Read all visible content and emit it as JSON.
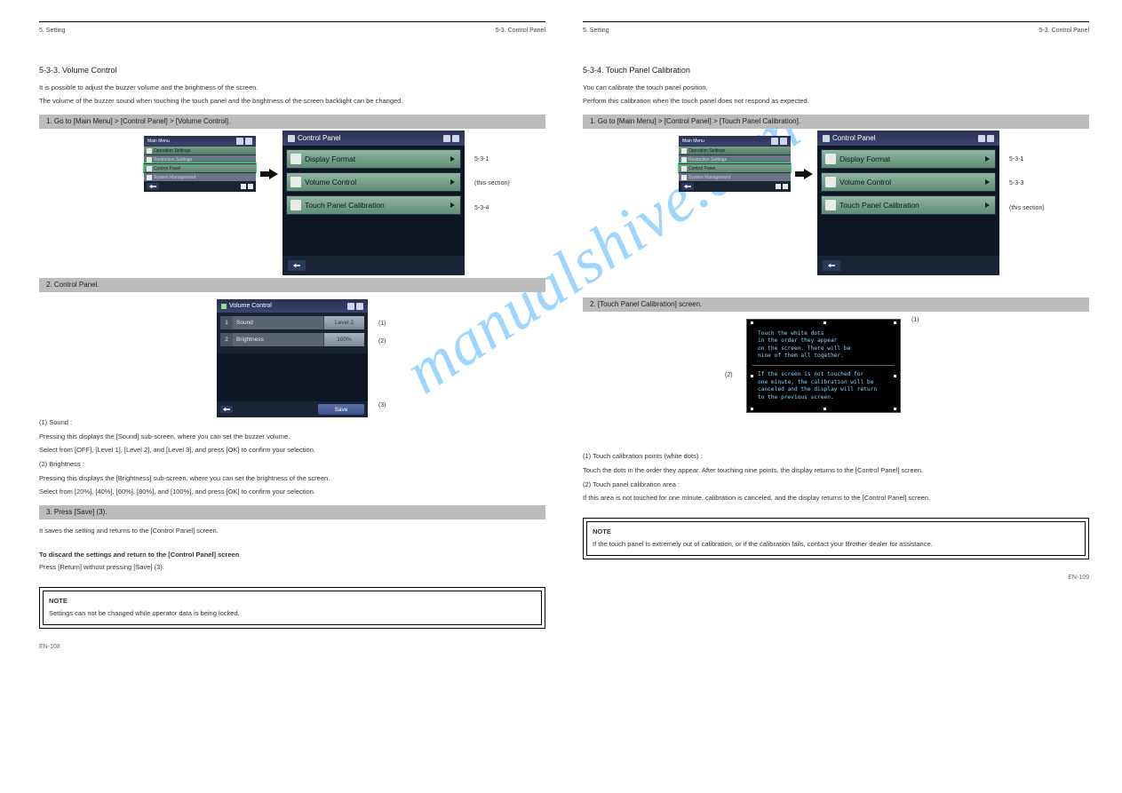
{
  "watermark": "manualshive.com",
  "left": {
    "header": {
      "chapter": "5. Setting",
      "breadcrumb": "5-3. Control Panel"
    },
    "title": "5-3-3. Volume Control",
    "intro1": "It is possible to adjust the buzzer volume and the brightness of the screen.",
    "intro2": "The volume of the buzzer sound when touching the touch panel and the brightness of the screen backlight can be changed.",
    "step1": {
      "bar": "1. Go to [Main Menu] > [Control Panel] > [Volume Control].",
      "mainmenu": {
        "title": "Main Menu",
        "items": [
          "Operation Settings",
          "Restriction Settings",
          "Control Panel",
          "System Management"
        ]
      },
      "cp": {
        "title": "Control Panel",
        "items": [
          "Display Format",
          "Volume Control",
          "Touch Panel Calibration"
        ]
      },
      "callouts": {
        "a": "5-3-1",
        "b": "(this section)",
        "c": "5-3-4"
      }
    },
    "step2": {
      "bar": "2. Control Panel.",
      "vc": {
        "title": "Volume Control",
        "row1_lbl": "Sound",
        "row1_val": "Level 2",
        "row2_lbl": "Brightness",
        "row2_val": "100%",
        "save": "Save"
      },
      "callouts": {
        "a": "(1)",
        "b": "(2)",
        "c": "(3)"
      },
      "desc1_h": "(1) Sound :",
      "desc1": "Pressing this displays the [Sound] sub-screen, where you can set the buzzer volume.",
      "desc1b": "Select from [OFF], [Level 1], [Level 2], and [Level 3], and press [OK] to confirm your selection.",
      "desc2_h": "(2) Brightness :",
      "desc2": "Pressing this displays the [Brightness] sub-screen, where you can set the brightness of the screen.",
      "desc2b": "Select from [20%], [40%], [60%], [80%], and [100%], and press [OK] to confirm your selection."
    },
    "step3": {
      "bar": "3. Press [Save] (3).",
      "text": "It saves the setting and returns to the [Control Panel] screen.",
      "abort_h": "To discard the settings and return to the [Control Panel] screen",
      "abort": "Press [Return] without pressing [Save] (3)."
    },
    "note": {
      "title": "NOTE",
      "text": "Settings can not be changed while operator data is being locked."
    },
    "page": "EN-108"
  },
  "right": {
    "header": {
      "chapter": "5. Setting",
      "breadcrumb": "5-3. Control Panel"
    },
    "title": "5-3-4. Touch Panel Calibration",
    "intro1": "You can calibrate the touch panel position.",
    "intro2": "Perform this calibration when the touch panel does not respond as expected.",
    "step1": {
      "bar": "1. Go to [Main Menu] > [Control Panel] > [Touch Panel Calibration].",
      "mainmenu": {
        "title": "Main Menu",
        "items": [
          "Operation Settings",
          "Restriction Settings",
          "Control Panel",
          "System Management"
        ]
      },
      "cp": {
        "title": "Control Panel",
        "items": [
          "Display Format",
          "Volume Control",
          "Touch Panel Calibration"
        ]
      },
      "callouts": {
        "a": "5-3-1",
        "b": "5-3-3",
        "c": "(this section)"
      }
    },
    "step2": {
      "bar": "2. [Touch Panel Calibration] screen.",
      "calib_line1": "Touch the white dots",
      "calib_line2": "in the order they appear",
      "calib_line3": "on the screen. There will be",
      "calib_line4": "nine of them all together.",
      "calib_line5": "If the screen is not touched for",
      "calib_line6": "one minute, the calibration will be",
      "calib_line7": "canceled and the display will return",
      "calib_line8": "to the previous screen.",
      "call_a": "(1)",
      "call_b": "(2)",
      "desc_h": "(1) Touch calibration points (white dots) :",
      "desc": "Touch the dots in the order they appear. After touching nine points, the display returns to the [Control Panel] screen.",
      "desc2_h": "(2) Touch panel calibration area :",
      "desc2": "If this area is not touched for one minute, calibration is canceled, and the display returns to the [Control Panel] screen."
    },
    "note": {
      "title": "NOTE",
      "text": "If the touch panel is extremely out of calibration, or if the calibration fails, contact your Brother dealer for assistance."
    },
    "page": "EN-109"
  }
}
